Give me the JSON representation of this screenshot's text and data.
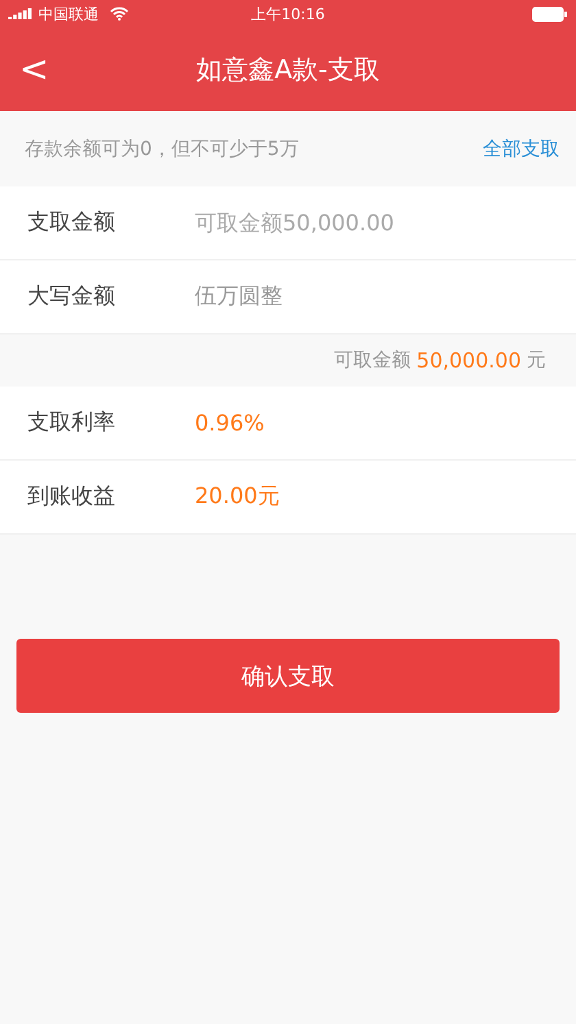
{
  "status_bar": {
    "carrier": "中国联通",
    "time": "上午10:16"
  },
  "header": {
    "back": "<",
    "title": "如意鑫A款-支取"
  },
  "notice": {
    "text": "存款余额可为0，但不可少于5万",
    "link": "全部支取"
  },
  "form_rows": [
    {
      "kind": "input",
      "label": "支取金额",
      "placeholder": "可取金额50,000.00"
    },
    {
      "kind": "text",
      "label": "大写金额",
      "value": "伍万圆整"
    }
  ],
  "available": {
    "label": "可取金额",
    "amount": "50,000.00",
    "unit": "元"
  },
  "info_rows": [
    {
      "kind": "highlight",
      "label": "支取利率",
      "value": "0.96%"
    },
    {
      "kind": "highlight",
      "label": "到账收益",
      "value": "20.00元"
    }
  ],
  "button": "确认支取"
}
